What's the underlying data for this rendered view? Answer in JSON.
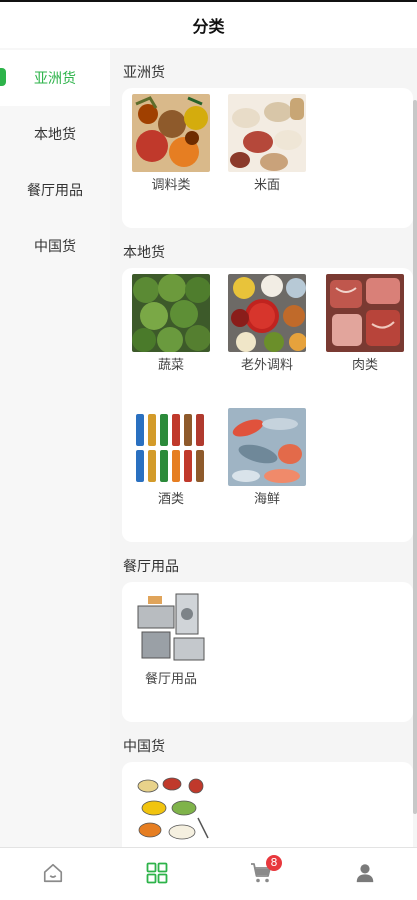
{
  "header": {
    "title": "分类"
  },
  "sidebar": {
    "items": [
      {
        "label": "亚洲货",
        "active": true
      },
      {
        "label": "本地货",
        "active": false
      },
      {
        "label": "餐厅用品",
        "active": false
      },
      {
        "label": "中国货",
        "active": false
      }
    ]
  },
  "sections": [
    {
      "title": "亚洲货",
      "items": [
        {
          "label": "调料类",
          "image": "spices"
        },
        {
          "label": "米面",
          "image": "grains"
        }
      ]
    },
    {
      "title": "本地货",
      "items": [
        {
          "label": "蔬菜",
          "image": "broccoli"
        },
        {
          "label": "老外调料",
          "image": "sauces"
        },
        {
          "label": "肉类",
          "image": "meat"
        },
        {
          "label": "酒类",
          "image": "bottles"
        },
        {
          "label": "海鲜",
          "image": "seafood"
        }
      ]
    },
    {
      "title": "餐厅用品",
      "items": [
        {
          "label": "餐厅用品",
          "image": "kitchen-equipment"
        }
      ]
    },
    {
      "title": "中国货",
      "items": [
        {
          "label": "",
          "image": "chinese-food-illustration"
        }
      ]
    }
  ],
  "tabbar": {
    "items": [
      {
        "name": "home",
        "icon": "home-icon",
        "active": false
      },
      {
        "name": "category",
        "icon": "grid-icon",
        "active": true
      },
      {
        "name": "cart",
        "icon": "cart-icon",
        "active": false,
        "badge": "8"
      },
      {
        "name": "profile",
        "icon": "user-icon",
        "active": false
      }
    ]
  },
  "colors": {
    "accent": "#2db34a",
    "badge": "#e8383d",
    "inactive_icon": "#8a8a8a"
  }
}
